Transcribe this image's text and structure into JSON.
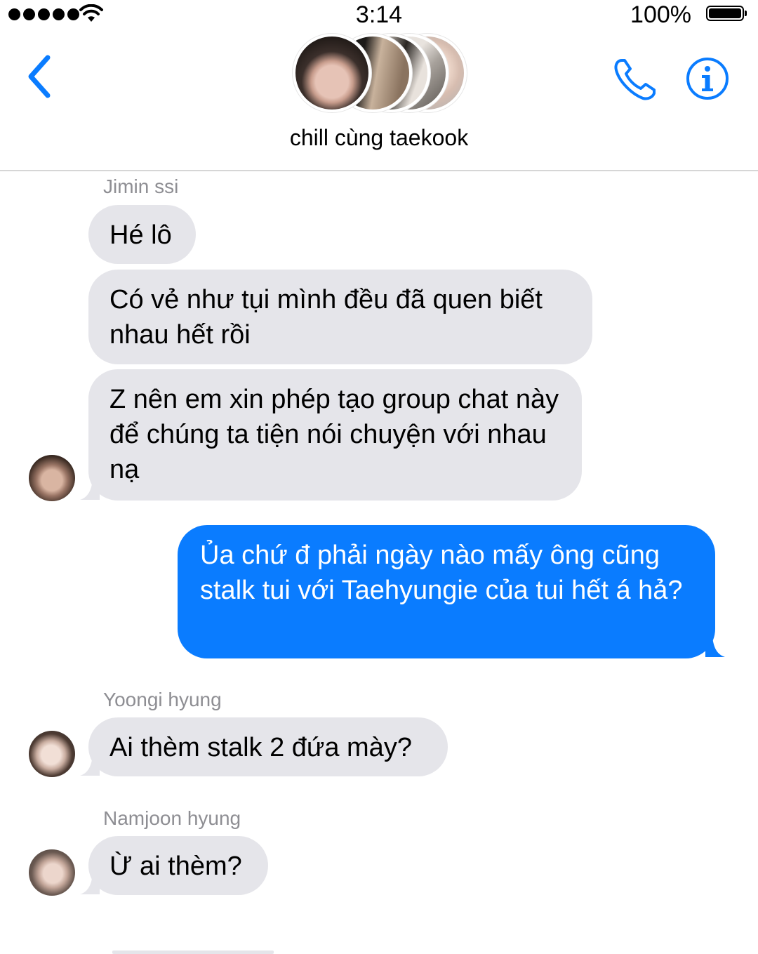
{
  "status_bar": {
    "time": "3:14",
    "battery": "100%"
  },
  "nav": {
    "group_name": "chill cùng taekook"
  },
  "messages": [
    {
      "sender": "Jimin ssi",
      "text": "Hé lô"
    },
    {
      "text": "Có vẻ như tụi mình đều đã quen biết nhau hết rồi"
    },
    {
      "text": "Z nên em xin phép tạo group chat này để chúng ta tiện nói chuyện với nhau nạ"
    },
    {
      "text": "Ủa chứ đ phải ngày nào mấy ông cũng stalk tui với Taehyungie của tui hết á hả?"
    },
    {
      "sender": "Yoongi hyung",
      "text": "Ai thèm stalk 2 đứa mày?"
    },
    {
      "sender": "Namjoon hyung",
      "text": "Ừ ai thèm?"
    }
  ],
  "colors": {
    "accent": "#0a7cff",
    "incoming_bubble": "#e5e5ea",
    "sender_label": "#8e8e93"
  },
  "icons": {
    "back": "chevron-left-icon",
    "call": "phone-icon",
    "info": "info-icon"
  }
}
